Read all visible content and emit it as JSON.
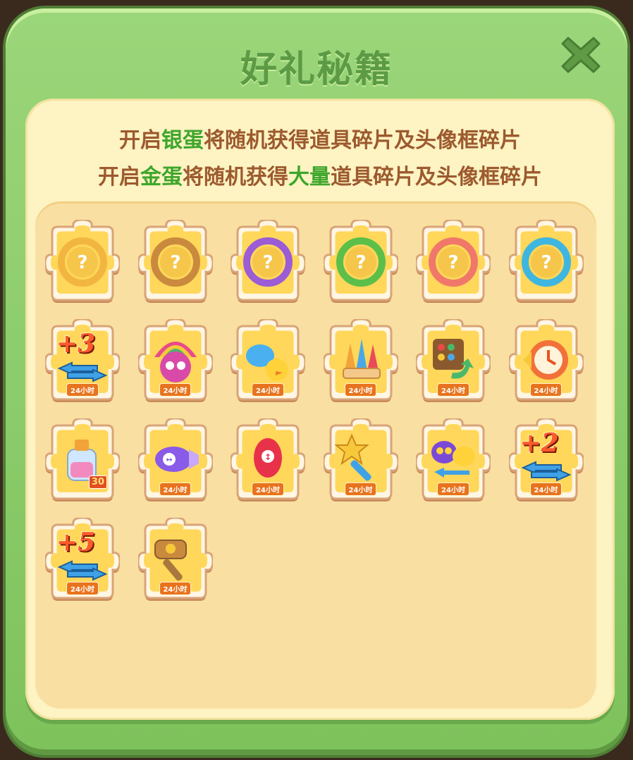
{
  "dialog": {
    "title": "好礼秘籍",
    "close_icon": "close-x-icon",
    "desc_line1": {
      "pre": "开启",
      "egg": "银蛋",
      "post": "将随机获得道具碎片及头像框碎片"
    },
    "desc_line2": {
      "pre": "开启",
      "egg": "金蛋",
      "mid": "将随机获得",
      "big": "大量",
      "post": "道具碎片及头像框碎片"
    }
  },
  "colors": {
    "frame_green": "#8cce6a",
    "title_green": "#5c9a45",
    "text_brown": "#9c5a2e",
    "highlight_green": "#3fa62c",
    "tile_yellow": "#ffd75a",
    "tag_orange": "#e8731e"
  },
  "items": [
    {
      "name": "avatar-frame-cake-icon",
      "tag": ""
    },
    {
      "name": "avatar-frame-bear-icon",
      "tag": ""
    },
    {
      "name": "avatar-frame-witch-icon",
      "tag": ""
    },
    {
      "name": "avatar-frame-frog-icon",
      "tag": ""
    },
    {
      "name": "avatar-frame-cat-icon",
      "tag": ""
    },
    {
      "name": "avatar-frame-bluebear-icon",
      "tag": ""
    },
    {
      "name": "plus3-moves-icon",
      "tag": "24小时",
      "plus": "+3"
    },
    {
      "name": "rainbow-bird-icon",
      "tag": "24小时"
    },
    {
      "name": "hippo-chick-icon",
      "tag": "24小时"
    },
    {
      "name": "rocket-bundle-icon",
      "tag": "24小时"
    },
    {
      "name": "shuffle-board-icon",
      "tag": "24小时"
    },
    {
      "name": "alarm-clock-icon",
      "tag": "24小时"
    },
    {
      "name": "rainbow-bottle-icon",
      "tag": "",
      "badge": "30"
    },
    {
      "name": "horizontal-rocket-icon",
      "tag": "24小时"
    },
    {
      "name": "vertical-rocket-icon",
      "tag": "24小时"
    },
    {
      "name": "magic-wand-icon",
      "tag": "24小时"
    },
    {
      "name": "owl-chick-swap-icon",
      "tag": "24小时"
    },
    {
      "name": "plus2-moves-icon",
      "tag": "24小时",
      "plus": "+2"
    },
    {
      "name": "plus5-moves-icon",
      "tag": "24小时",
      "plus": "+5"
    },
    {
      "name": "hammer-icon",
      "tag": "24小时"
    }
  ]
}
